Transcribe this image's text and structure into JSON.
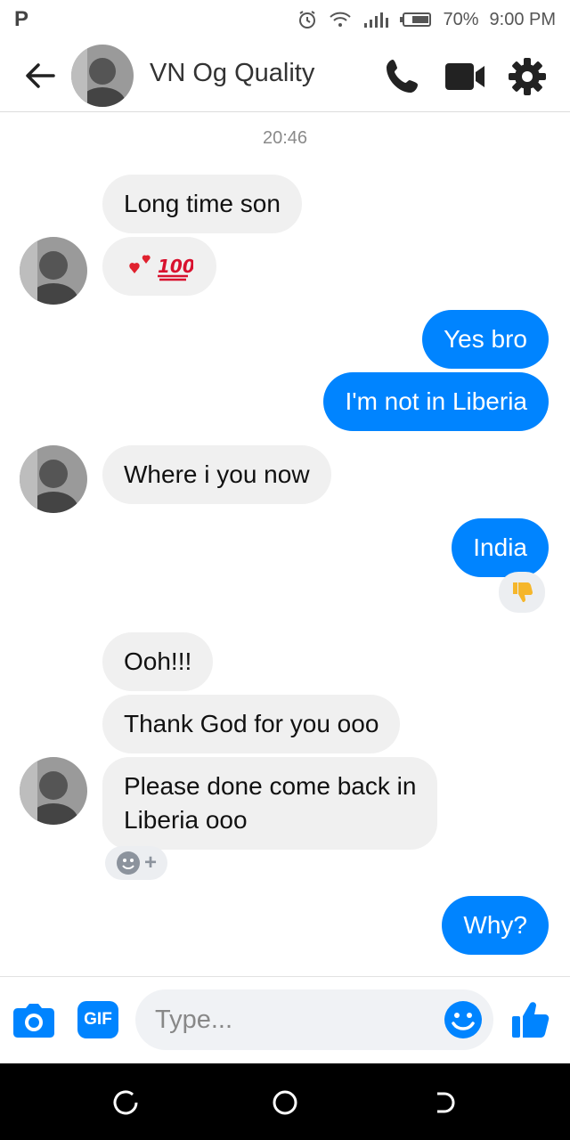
{
  "status_bar": {
    "carrier_glyph": "P",
    "battery": "70%",
    "time": "9:00 PM",
    "icons": [
      "alarm-icon",
      "wifi-icon",
      "signal-icon",
      "battery-icon"
    ]
  },
  "header": {
    "contact_name": "VN Og Quality",
    "icons": [
      "back-arrow-icon",
      "phone-icon",
      "video-camera-icon",
      "gear-icon"
    ]
  },
  "conversation": {
    "timestamp": "20:46",
    "messages": [
      {
        "from": "contact",
        "text": "Long time son"
      },
      {
        "from": "contact",
        "text": "❤️💯",
        "emoji": true
      },
      {
        "from": "me",
        "text": "Yes bro"
      },
      {
        "from": "me",
        "text": "I'm not in Liberia"
      },
      {
        "from": "contact",
        "text": "Where i you now"
      },
      {
        "from": "me",
        "text": "India",
        "reaction": "thumbs-down"
      },
      {
        "from": "contact",
        "text": "Ooh!!!"
      },
      {
        "from": "contact",
        "text": "Thank God for you ooo"
      },
      {
        "from": "contact",
        "text_lines": [
          "Please done come back in",
          "Liberia ooo"
        ],
        "reaction_prompt": "+"
      },
      {
        "from": "me",
        "text": "Why?"
      }
    ]
  },
  "composer": {
    "placeholder": "Type...",
    "gif_label": "GIF",
    "icons": [
      "camera-icon",
      "gif-icon",
      "emoji-icon",
      "thumbs-up-icon"
    ]
  },
  "colors": {
    "accent": "#0084ff",
    "incoming_bubble": "#f0f0f0",
    "reaction_yellow": "#f5b62b"
  }
}
